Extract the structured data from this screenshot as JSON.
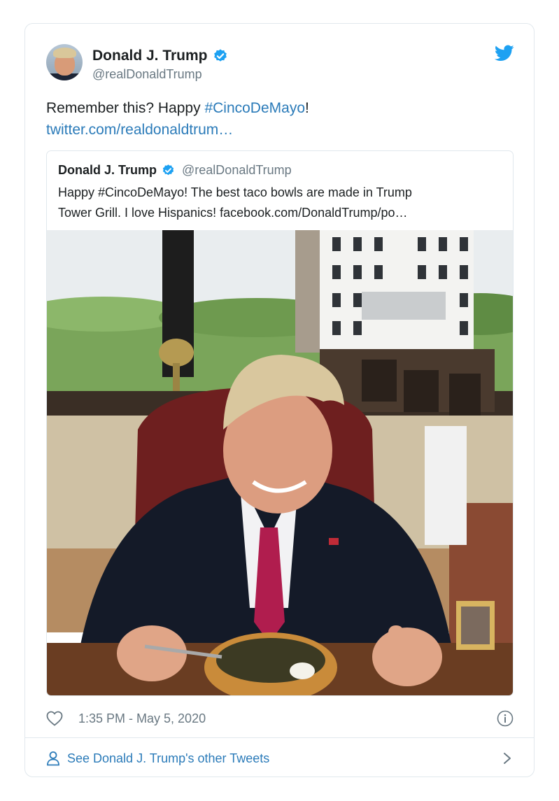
{
  "tweet": {
    "author_name": "Donald J. Trump",
    "handle": "@realDonaldTrump",
    "text_prefix": "Remember this? Happy ",
    "hashtag": "#CincoDeMayo",
    "text_suffix": "!",
    "link": "twitter.com/realdonaldtrum…",
    "timestamp": "1:35 PM - May 5, 2020"
  },
  "quoted_tweet": {
    "author_name": "Donald J. Trump",
    "handle": "@realDonaldTrump",
    "text_line1": "Happy #CincoDeMayo! The best taco bowls are made in Trump",
    "text_line2": "Tower Grill. I love Hispanics! facebook.com/DonaldTrump/po…"
  },
  "footer": {
    "label": "See Donald J. Trump's other Tweets"
  },
  "icons": {
    "verified": "verified-badge-icon",
    "brand": "twitter-bird-icon",
    "like": "heart-icon",
    "info": "info-icon",
    "profile": "person-icon",
    "chevron": "chevron-right-icon"
  },
  "colors": {
    "link": "#2b7bb9",
    "verified": "#1da1f2",
    "muted_text": "#697882",
    "border": "#e1e8ed"
  }
}
